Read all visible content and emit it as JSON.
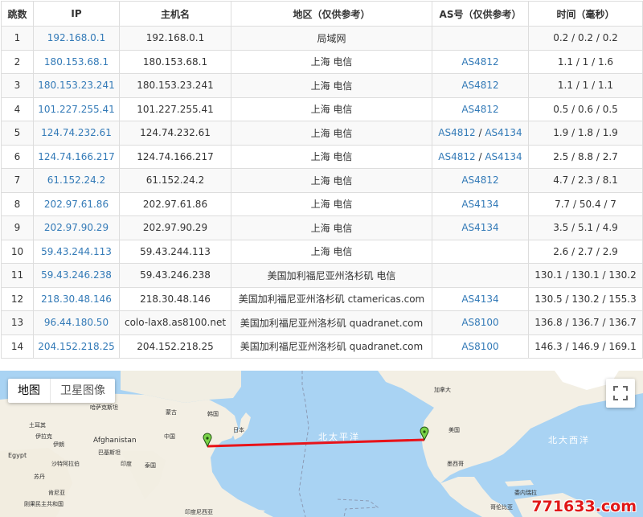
{
  "table": {
    "headers": [
      "跳数",
      "IP",
      "主机名",
      "地区（仅供参考）",
      "AS号（仅供参考）",
      "时间（毫秒）"
    ],
    "rows": [
      {
        "hop": "1",
        "ip": "192.168.0.1",
        "host": "192.168.0.1",
        "region": "局域网",
        "as": [],
        "time": "0.2 / 0.2 / 0.2"
      },
      {
        "hop": "2",
        "ip": "180.153.68.1",
        "host": "180.153.68.1",
        "region": "上海 电信",
        "as": [
          "AS4812"
        ],
        "time": "1.1 / 1 / 1.6"
      },
      {
        "hop": "3",
        "ip": "180.153.23.241",
        "host": "180.153.23.241",
        "region": "上海 电信",
        "as": [
          "AS4812"
        ],
        "time": "1.1 / 1 / 1.1"
      },
      {
        "hop": "4",
        "ip": "101.227.255.41",
        "host": "101.227.255.41",
        "region": "上海 电信",
        "as": [
          "AS4812"
        ],
        "time": "0.5 / 0.6 / 0.5"
      },
      {
        "hop": "5",
        "ip": "124.74.232.61",
        "host": "124.74.232.61",
        "region": "上海 电信",
        "as": [
          "AS4812",
          "AS4134"
        ],
        "time": "1.9 / 1.8 / 1.9"
      },
      {
        "hop": "6",
        "ip": "124.74.166.217",
        "host": "124.74.166.217",
        "region": "上海 电信",
        "as": [
          "AS4812",
          "AS4134"
        ],
        "time": "2.5 / 8.8 / 2.7"
      },
      {
        "hop": "7",
        "ip": "61.152.24.2",
        "host": "61.152.24.2",
        "region": "上海 电信",
        "as": [
          "AS4812"
        ],
        "time": "4.7 / 2.3 / 8.1"
      },
      {
        "hop": "8",
        "ip": "202.97.61.86",
        "host": "202.97.61.86",
        "region": "上海 电信",
        "as": [
          "AS4134"
        ],
        "time": "7.7 / 50.4 / 7"
      },
      {
        "hop": "9",
        "ip": "202.97.90.29",
        "host": "202.97.90.29",
        "region": "上海 电信",
        "as": [
          "AS4134"
        ],
        "time": "3.5 / 5.1 / 4.9"
      },
      {
        "hop": "10",
        "ip": "59.43.244.113",
        "host": "59.43.244.113",
        "region": "上海 电信",
        "as": [],
        "time": "2.6 / 2.7 / 2.9"
      },
      {
        "hop": "11",
        "ip": "59.43.246.238",
        "host": "59.43.246.238",
        "region": "美国加利福尼亚州洛杉矶 电信",
        "as": [],
        "time": "130.1 / 130.1 / 130.2"
      },
      {
        "hop": "12",
        "ip": "218.30.48.146",
        "host": "218.30.48.146",
        "region": "美国加利福尼亚州洛杉矶 ctamericas.com",
        "as": [
          "AS4134"
        ],
        "time": "130.5 / 130.2 / 155.3"
      },
      {
        "hop": "13",
        "ip": "96.44.180.50",
        "host": "colo-lax8.as8100.net",
        "region": "美国加利福尼亚州洛杉矶 quadranet.com",
        "as": [
          "AS8100"
        ],
        "time": "136.8 / 136.7 / 136.7"
      },
      {
        "hop": "14",
        "ip": "204.152.218.25",
        "host": "204.152.218.25",
        "region": "美国加利福尼亚州洛杉矶 quadranet.com",
        "as": [
          "AS8100"
        ],
        "time": "146.3 / 146.9 / 169.1"
      }
    ]
  },
  "map": {
    "type_buttons": {
      "map": "地图",
      "satellite": "卫星图像"
    },
    "fullscreen_icon": "fullscreen-icon",
    "labels": {
      "pacific": "北太平洋",
      "atlantic": "北大西洋",
      "afghanistan": "Afghanistan",
      "korea": "韩国",
      "japan": "日本",
      "mongolia": "蒙古",
      "kazakhstan": "哈萨克斯坦",
      "china": "中国",
      "india": "印度",
      "iran": "伊朗",
      "iraq": "伊拉克",
      "egypt": "Egypt",
      "saudi": "沙特阿拉伯",
      "pakistan": "巴基斯坦",
      "canada": "加拿大",
      "usa": "美国",
      "mexico": "墨西哥",
      "turkey": "土耳其",
      "sudan": "苏丹",
      "venezuela": "委内瑞拉",
      "congo": "刚果民主共和国",
      "kenya": "肯尼亚",
      "indonesia": "印度尼西亚",
      "colombia": "哥伦比亚",
      "thailand": "泰国"
    },
    "line_color": "#e8141a",
    "pin_color": "#7ad348"
  },
  "watermark": "771633.com"
}
